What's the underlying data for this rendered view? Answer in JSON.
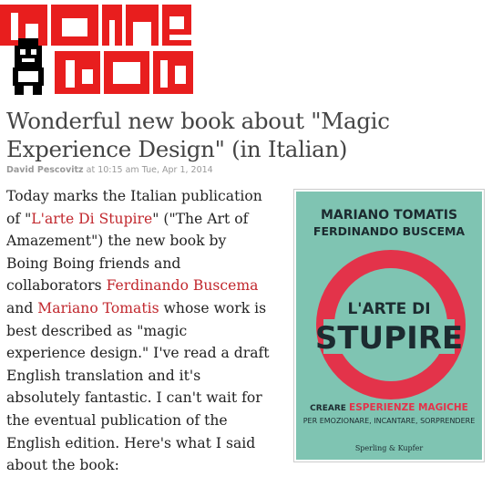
{
  "site": {
    "logo_alt": "boing boing"
  },
  "post": {
    "title": "Wonderful new book about \"Magic Experience Design\" (in Italian)",
    "author": "David Pescovitz",
    "at": "at",
    "time": "10:15 am",
    "date": "Tue, Apr 1, 2014",
    "body": {
      "t1": "Today marks the Italian publication of \"",
      "link1": "L'arte Di Stupire",
      "t2": "\" (\"The Art of Amazement\") the new book by Boing Boing friends and collaborators ",
      "link2": "Ferdinando Buscema",
      "t3": " and ",
      "link3": "Mariano Tomatis",
      "t4": " whose work is best described as \"magic experience design.\" I've read a draft English translation and it's absolutely fantastic. I can't wait for the eventual publication of the English edition. Here's what I said about the book:"
    }
  },
  "book_cover": {
    "author1": "MARIANO TOMATIS",
    "author2": "FERDINANDO BUSCEMA",
    "title1": "L'ARTE DI",
    "title2": "STUPIRE",
    "subtitle_a": "CREARE",
    "subtitle_b": "ESPERIENZE MAGICHE",
    "subtitle2": "PER EMOZIONARE, INCANTARE, SORPRENDERE",
    "publisher": "Sperling & Kupfer",
    "colors": {
      "background": "#7fc4b2",
      "accent": "#e3334a",
      "ink": "#1c2b30"
    }
  }
}
